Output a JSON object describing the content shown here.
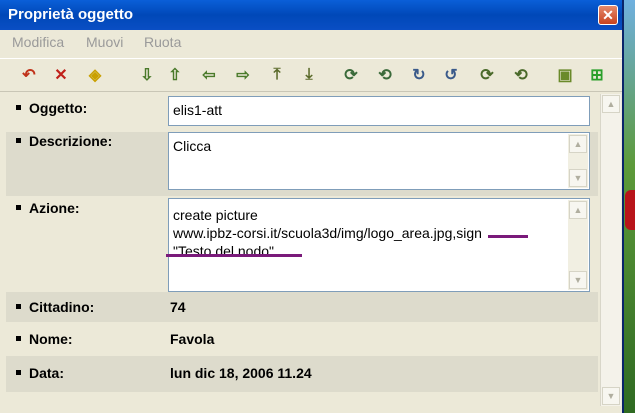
{
  "window": {
    "title": "Proprietà oggetto",
    "close_symbol": "✕"
  },
  "menu": {
    "items": [
      "Modifica",
      "Muovi",
      "Ruota"
    ]
  },
  "toolbar": {
    "icons": [
      {
        "name": "undo-icon",
        "glyph": "↶",
        "color": "#c0321a"
      },
      {
        "name": "delete-icon",
        "glyph": "✕",
        "color": "#c0201a"
      },
      {
        "name": "cube-icon",
        "glyph": "◈",
        "color": "#c9a000"
      },
      {
        "name": "move-down-icon",
        "glyph": "⇩",
        "color": "#4a7a2a"
      },
      {
        "name": "move-up-icon",
        "glyph": "⇧",
        "color": "#4a7a2a"
      },
      {
        "name": "move-left-icon",
        "glyph": "⇦",
        "color": "#4a7a2a"
      },
      {
        "name": "move-right-icon",
        "glyph": "⇨",
        "color": "#4a7a2a"
      },
      {
        "name": "raise-icon",
        "glyph": "⤒",
        "color": "#5a6a2a"
      },
      {
        "name": "lower-icon",
        "glyph": "⤓",
        "color": "#5a6a2a"
      },
      {
        "name": "rotate-1-icon",
        "glyph": "⟳",
        "color": "#3a6a3a"
      },
      {
        "name": "rotate-2-icon",
        "glyph": "⟲",
        "color": "#3a6a3a"
      },
      {
        "name": "rotate-3-icon",
        "glyph": "↻",
        "color": "#3a5a8a"
      },
      {
        "name": "rotate-4-icon",
        "glyph": "↺",
        "color": "#3a5a8a"
      },
      {
        "name": "rotate-5-icon",
        "glyph": "⟳",
        "color": "#4a6a2a"
      },
      {
        "name": "rotate-6-icon",
        "glyph": "⟲",
        "color": "#4a6a2a"
      },
      {
        "name": "scale-icon",
        "glyph": "▣",
        "color": "#6a8a2a"
      },
      {
        "name": "select-icon",
        "glyph": "⊞",
        "color": "#2aa02a"
      }
    ]
  },
  "properties": {
    "oggetto": {
      "label": "Oggetto:",
      "value": "elis1-att"
    },
    "descrizione": {
      "label": "Descrizione:",
      "value": "Clicca"
    },
    "azione": {
      "label": "Azione:",
      "value": "create picture\nwww.ipbz-corsi.it/scuola3d/img/logo_area.jpg,sign\n\"Testo del nodo\""
    },
    "cittadino": {
      "label": "Cittadino:",
      "value": "74"
    },
    "nome": {
      "label": "Nome:",
      "value": "Favola"
    },
    "data": {
      "label": "Data:",
      "value": "lun dic 18, 2006 11.24"
    }
  },
  "scroll": {
    "up": "▲",
    "down": "▼"
  },
  "colors": {
    "titlebar": "#0a5fd8",
    "annotation": "#7a1a7a"
  }
}
